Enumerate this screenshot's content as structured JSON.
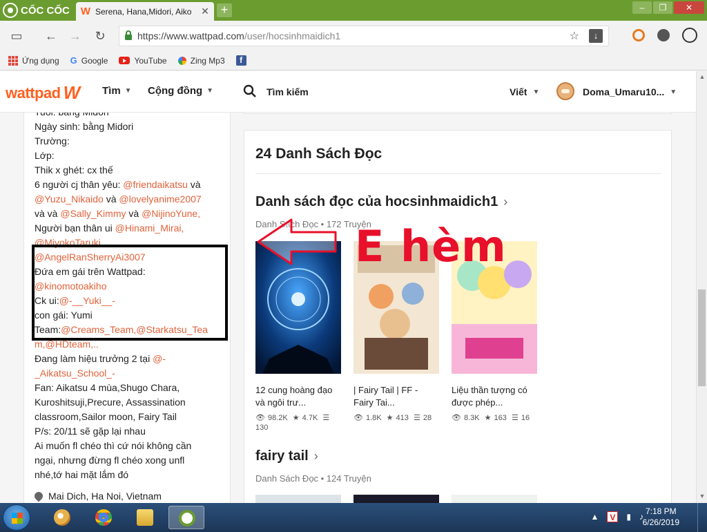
{
  "browser": {
    "brand": "CỐC CỐC",
    "tab_title": "Serena, Hana,Midori, Aiko",
    "tab_favicon": "W",
    "url_prefix": "https://www.wattpad.com",
    "url_rest": "/user/hocsinhmaidich1",
    "bookmarks": [
      "Ứng dụng",
      "Google",
      "YouTube",
      "Zing Mp3"
    ]
  },
  "header": {
    "logo": "wattpad",
    "nav": [
      "Tìm",
      "Cộng đồng"
    ],
    "search_label": "Tìm kiếm",
    "language": "Viết",
    "username": "Doma_Umaru10..."
  },
  "about": {
    "lines": [
      [
        {
          "t": "Tuổi: bằng Midori"
        }
      ],
      [
        {
          "t": "Ngày sinh: bằng Midori"
        }
      ],
      [
        {
          "t": "Trường:"
        }
      ],
      [
        {
          "t": "Lớp:"
        }
      ],
      [
        {
          "t": "Thik x ghét: cx thế"
        }
      ],
      [
        {
          "t": "6 người cj thân yêu: "
        },
        {
          "t": "@friendaikatsu",
          "link": true
        },
        {
          "t": " và"
        }
      ],
      [
        {
          "t": "@Yuzu_Nikaido",
          "link": true
        },
        {
          "t": "   và "
        },
        {
          "t": "@lovelyanime2007",
          "link": true
        }
      ],
      [
        {
          "t": "và và "
        },
        {
          "t": "@Sally_Kimmy",
          "link": true
        },
        {
          "t": " và "
        },
        {
          "t": "@NijinoYune,",
          "link": true
        }
      ],
      [
        {
          "t": "Người bạn thân ui "
        },
        {
          "t": "@Hinami_Mirai,",
          "link": true
        }
      ],
      [
        {
          "t": "@MiyokoTaruki,",
          "link": true
        }
      ],
      [
        {
          "t": "@AngelRanSherryAi3007",
          "link": true
        }
      ],
      [
        {
          "t": "Đứa em gái trên Wattpad:"
        }
      ],
      [
        {
          "t": "@kinomotoakiho",
          "link": true
        }
      ],
      [
        {
          "t": "Ck ui:"
        },
        {
          "t": "@-__Yuki__-",
          "link": true
        }
      ],
      [
        {
          "t": "con gái: Yumi"
        }
      ],
      [
        {
          "t": "Team:"
        },
        {
          "t": "@Creams_Team,@Starkatsu_Tea",
          "link": true
        }
      ],
      [
        {
          "t": "m,@HDteam,..",
          "link": true
        }
      ],
      [
        {
          "t": "Đang làm hiệu trưởng 2 tại "
        },
        {
          "t": "@-",
          "link": true
        }
      ],
      [
        {
          "t": "_Aikatsu_School_-",
          "link": true
        }
      ],
      [
        {
          "t": "Fan: Aikatsu 4 mùa,Shugo Chara,"
        }
      ],
      [
        {
          "t": "Kuroshitsuji,Precure, Assassination"
        }
      ],
      [
        {
          "t": "classroom,Sailor moon, Fairy Tail"
        }
      ],
      [
        {
          "t": "P/s: 20/11 sẽ gặp lại nhau"
        }
      ],
      [
        {
          "t": "Ai muốn fl chéo thì cứ nói không cần"
        }
      ],
      [
        {
          "t": "ngại, nhưng đừng fl chéo xong unfl"
        }
      ],
      [
        {
          "t": "nhé,tớ hai mặt lắm đó"
        }
      ]
    ],
    "location": "Mai Dich, Ha Noi, Vietnam"
  },
  "reading_lists": {
    "section_title": "24 Danh Sách Đọc",
    "lists": [
      {
        "title": "Danh sách đọc của hocsinhmaidich1",
        "meta": "Danh Sách Đọc • 172 Truyện",
        "books": [
          {
            "title": "12 cung hoàng đạo và ngôi trư...",
            "reads": "98.2K",
            "votes": "4.7K",
            "parts": "130"
          },
          {
            "title": "| Fairy Tail | FF - Fairy Tai...",
            "reads": "1.8K",
            "votes": "413",
            "parts": "28"
          },
          {
            "title": "Liệu thần tượng có được phép...",
            "reads": "8.3K",
            "votes": "163",
            "parts": "16"
          }
        ]
      },
      {
        "title": "fairy tail",
        "meta": "Danh Sách Đọc • 124 Truyện"
      }
    ]
  },
  "annotation": {
    "text": "E hèm",
    "color": "#e8102a"
  },
  "taskbar": {
    "time": "7:18 PM",
    "date": "6/26/2019"
  },
  "colors": {
    "wattpad_orange": "#ff6122",
    "link": "#e0623a",
    "browser_green": "#6b9c2f"
  }
}
